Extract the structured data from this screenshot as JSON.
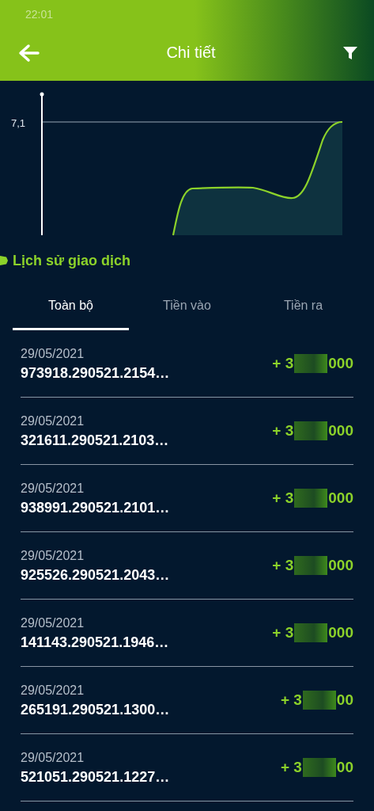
{
  "status_bar": {
    "time": "22:01"
  },
  "header": {
    "title": "Chi tiết"
  },
  "chart": {
    "y_tick": "7,1"
  },
  "section": {
    "title": "Lịch sử giao dịch"
  },
  "tabs": [
    {
      "label": "Toàn bộ",
      "selected": true
    },
    {
      "label": "Tiền vào",
      "selected": false
    },
    {
      "label": "Tiền ra",
      "selected": false
    }
  ],
  "transactions": [
    {
      "date": "29/05/2021",
      "reference": "973918.290521.2154…",
      "amount_start": "+ 3",
      "amount_end": "000"
    },
    {
      "date": "29/05/2021",
      "reference": "321611.290521.2103…",
      "amount_start": "+ 3",
      "amount_end": "000"
    },
    {
      "date": "29/05/2021",
      "reference": "938991.290521.2101…",
      "amount_start": "+ 3",
      "amount_end": "000"
    },
    {
      "date": "29/05/2021",
      "reference": "925526.290521.2043…",
      "amount_start": "+ 3",
      "amount_end": "000"
    },
    {
      "date": "29/05/2021",
      "reference": "141143.290521.1946…",
      "amount_start": "+ 3",
      "amount_end": "000"
    },
    {
      "date": "29/05/2021",
      "reference": "265191.290521.1300…",
      "amount_start": "+ 3",
      "amount_end": "00"
    },
    {
      "date": "29/05/2021",
      "reference": "521051.290521.1227…",
      "amount_start": "+ 3",
      "amount_end": "00"
    }
  ]
}
